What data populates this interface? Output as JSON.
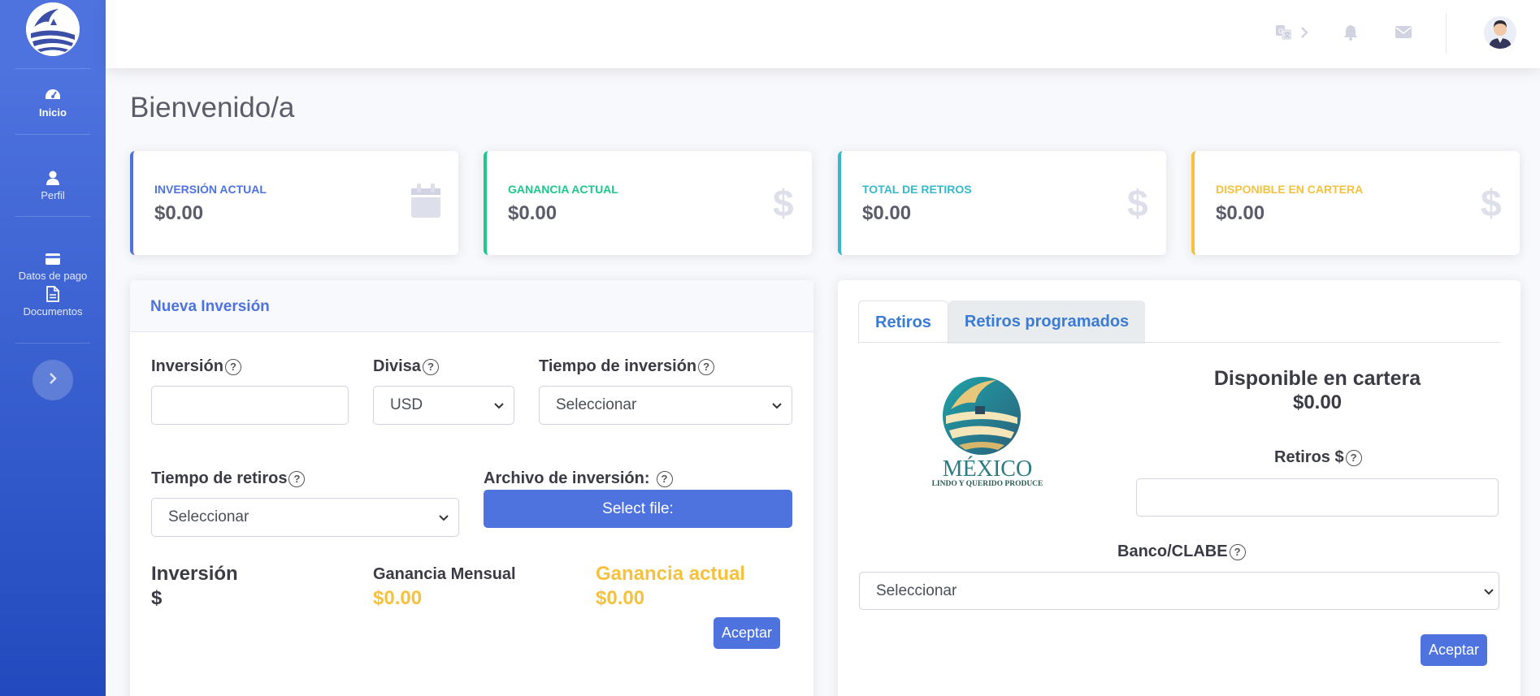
{
  "sidebar": {
    "items": [
      {
        "label": "Inicio",
        "icon": "dashboard-gauge-icon"
      },
      {
        "label": "Perfil",
        "icon": "user-icon"
      },
      {
        "label": "Datos de pago",
        "icon": "credit-card-icon"
      },
      {
        "label": "Documentos",
        "icon": "document-icon"
      }
    ],
    "toggle_icon": "chevron-right-icon"
  },
  "topbar": {
    "icons": [
      "translate-icon",
      "chevron-right-icon",
      "bell-icon",
      "envelope-icon"
    ],
    "avatar": "user-avatar"
  },
  "page": {
    "title": "Bienvenido/a"
  },
  "stats": [
    {
      "label": "Inversión actual",
      "value": "$0.00",
      "color": "#4e73df",
      "icon": "calendar-icon"
    },
    {
      "label": "Ganancia actual",
      "value": "$0.00",
      "color": "#1cc88a",
      "icon": "dollar-icon"
    },
    {
      "label": "Total de retiros",
      "value": "$0.00",
      "color": "#36b9cc",
      "icon": "dollar-icon"
    },
    {
      "label": "Disponible en cartera",
      "value": "$0.00",
      "color": "#f6c23e",
      "icon": "dollar-icon"
    }
  ],
  "investment": {
    "header": "Nueva Inversión",
    "inversion_label": "Inversión",
    "inversion_value": "",
    "divisa_label": "Divisa",
    "divisa_value": "USD",
    "tiempo_label": "Tiempo de inversión",
    "tiempo_value": "Seleccionar",
    "retiros_label": "Tiempo de retiros",
    "retiros_value": "Seleccionar",
    "archivo_label": "Archivo de inversión:",
    "select_file": "Select file:",
    "sum_inversion_title": "Inversión",
    "sum_inversion_value": "$",
    "sum_mensual_title": "Ganancia Mensual",
    "sum_mensual_value": "$0.00",
    "sum_actual_title": "Ganancia actual",
    "sum_actual_value": "$0.00",
    "accept": "Aceptar"
  },
  "withdrawals": {
    "tabs": [
      "Retiros",
      "Retiros programados"
    ],
    "active_tab": "Retiros",
    "logo_text": "MÉXICO",
    "logo_subtext": "LINDO Y QUERIDO PRODUCE",
    "available_title": "Disponible en cartera",
    "available_value": "$0.00",
    "retiros_label": "Retiros $",
    "retiros_value": "",
    "banco_label": "Banco/CLABE",
    "banco_value": "Seleccionar",
    "accept": "Aceptar"
  },
  "help_symbol": "?"
}
